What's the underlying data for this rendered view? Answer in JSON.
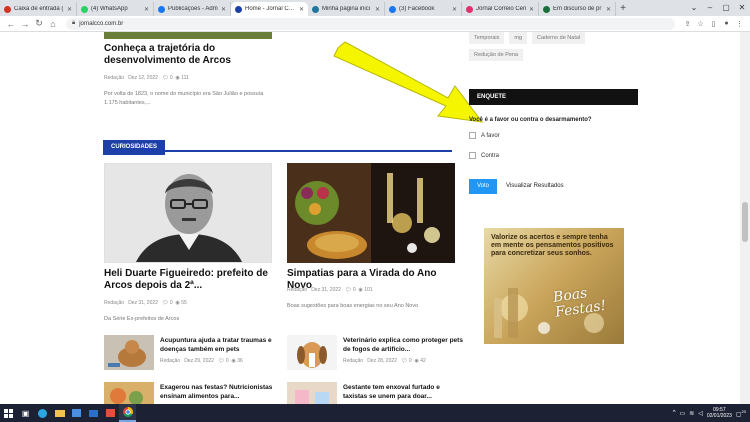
{
  "browser": {
    "tabs": [
      {
        "label": "Caixa de entrada (",
        "color": "#d93025",
        "active": false
      },
      {
        "label": "(4) WhatsApp",
        "color": "#25d366",
        "active": false
      },
      {
        "label": "Publicações - Adm",
        "color": "#1877f2",
        "active": false
      },
      {
        "label": "Home - Jornal Corre",
        "color": "#1d3fa8",
        "active": true
      },
      {
        "label": "Minha página inici",
        "color": "#21759b",
        "active": false
      },
      {
        "label": "(3) Facebook",
        "color": "#1877f2",
        "active": false
      },
      {
        "label": "Jornal Correio Cen",
        "color": "#e1306c",
        "active": false
      },
      {
        "label": "Em discurso de pr",
        "color": "#1a6e3a",
        "active": false
      }
    ],
    "new_tab": "+",
    "url": "jornalcco.com.br"
  },
  "article_top": {
    "title": "Conheça a trajetória do desenvolvimento de Arcos",
    "author": "Redação",
    "date": "Dez 12, 2022",
    "comments": "0",
    "views": "111",
    "excerpt": "Por volta de 1823, o nome do município era São Julião e possuía 1.175 habitantes,..."
  },
  "section": {
    "title": "CURIOSIDADES"
  },
  "feature_left": {
    "title": "Heli Duarte Figueiredo: prefeito de Arcos depois da 2ª...",
    "author": "Redação",
    "date": "Dez 31, 2022",
    "comments": "0",
    "views": "55",
    "excerpt": "Da Série Ex-prefeitos de Arcos"
  },
  "feature_right": {
    "title": "Simpatias para a Virada do Ano Novo",
    "author": "Redação",
    "date": "Dez 31, 2022",
    "comments": "0",
    "views": "101",
    "excerpt": "Boas sugestões para boas energias no seu Ano Novo"
  },
  "small_articles": [
    {
      "title": "Acupuntura ajuda a tratar traumas e doenças também em pets",
      "author": "Redação",
      "date": "Dez 29, 2022",
      "comments": "0",
      "views": "36"
    },
    {
      "title": "Veterinário explica como proteger pets de fogos de artifício...",
      "author": "Redação",
      "date": "Dez 28, 2022",
      "comments": "0",
      "views": "42"
    },
    {
      "title": "Exagerou nas festas? Nutricionistas ensinam alimentos para...",
      "author": "",
      "date": "",
      "comments": "",
      "views": ""
    },
    {
      "title": "Gestante tem enxoval furtado e taxistas se unem para doar...",
      "author": "",
      "date": "",
      "comments": "",
      "views": ""
    }
  ],
  "tags": [
    "Temporais",
    "mg",
    "Caderno de Natal",
    "Redução de Pena"
  ],
  "poll": {
    "header": "ENQUETE",
    "question": "Você é a favor ou contra o desarmamento?",
    "options": [
      "A favor",
      "Contra"
    ],
    "vote_label": "Voto",
    "results_label": "Visualizar Resultados"
  },
  "ad": {
    "text": "Valorize os acertos e sempre tenha em  mente os pensamentos positivos para concretizar seus sonhos.",
    "script_text": "Boas Festas!"
  },
  "taskbar": {
    "time": "09:57",
    "date": "02/01/2023",
    "notifications": "20"
  },
  "colors": {
    "accent": "#1d3fa8",
    "poll_button": "#2196f3",
    "arrow": "#f5f500"
  }
}
